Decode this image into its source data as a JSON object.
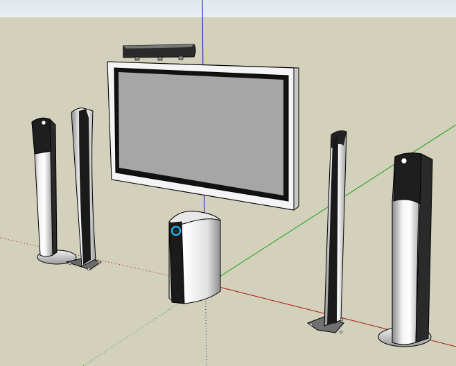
{
  "scene": {
    "sky_color": "#e4ebef",
    "ground_color": "#d3d0bb",
    "axes": {
      "red": "#b01010",
      "green": "#1aa01a",
      "blue": "#1a1ab8"
    },
    "objects": [
      "tv-screen",
      "center-speaker",
      "subwoofer",
      "front-left-tower",
      "rear-left-tower",
      "front-right-tower",
      "rear-right-tower"
    ],
    "accent_ring_color": "#1ab0e0"
  }
}
